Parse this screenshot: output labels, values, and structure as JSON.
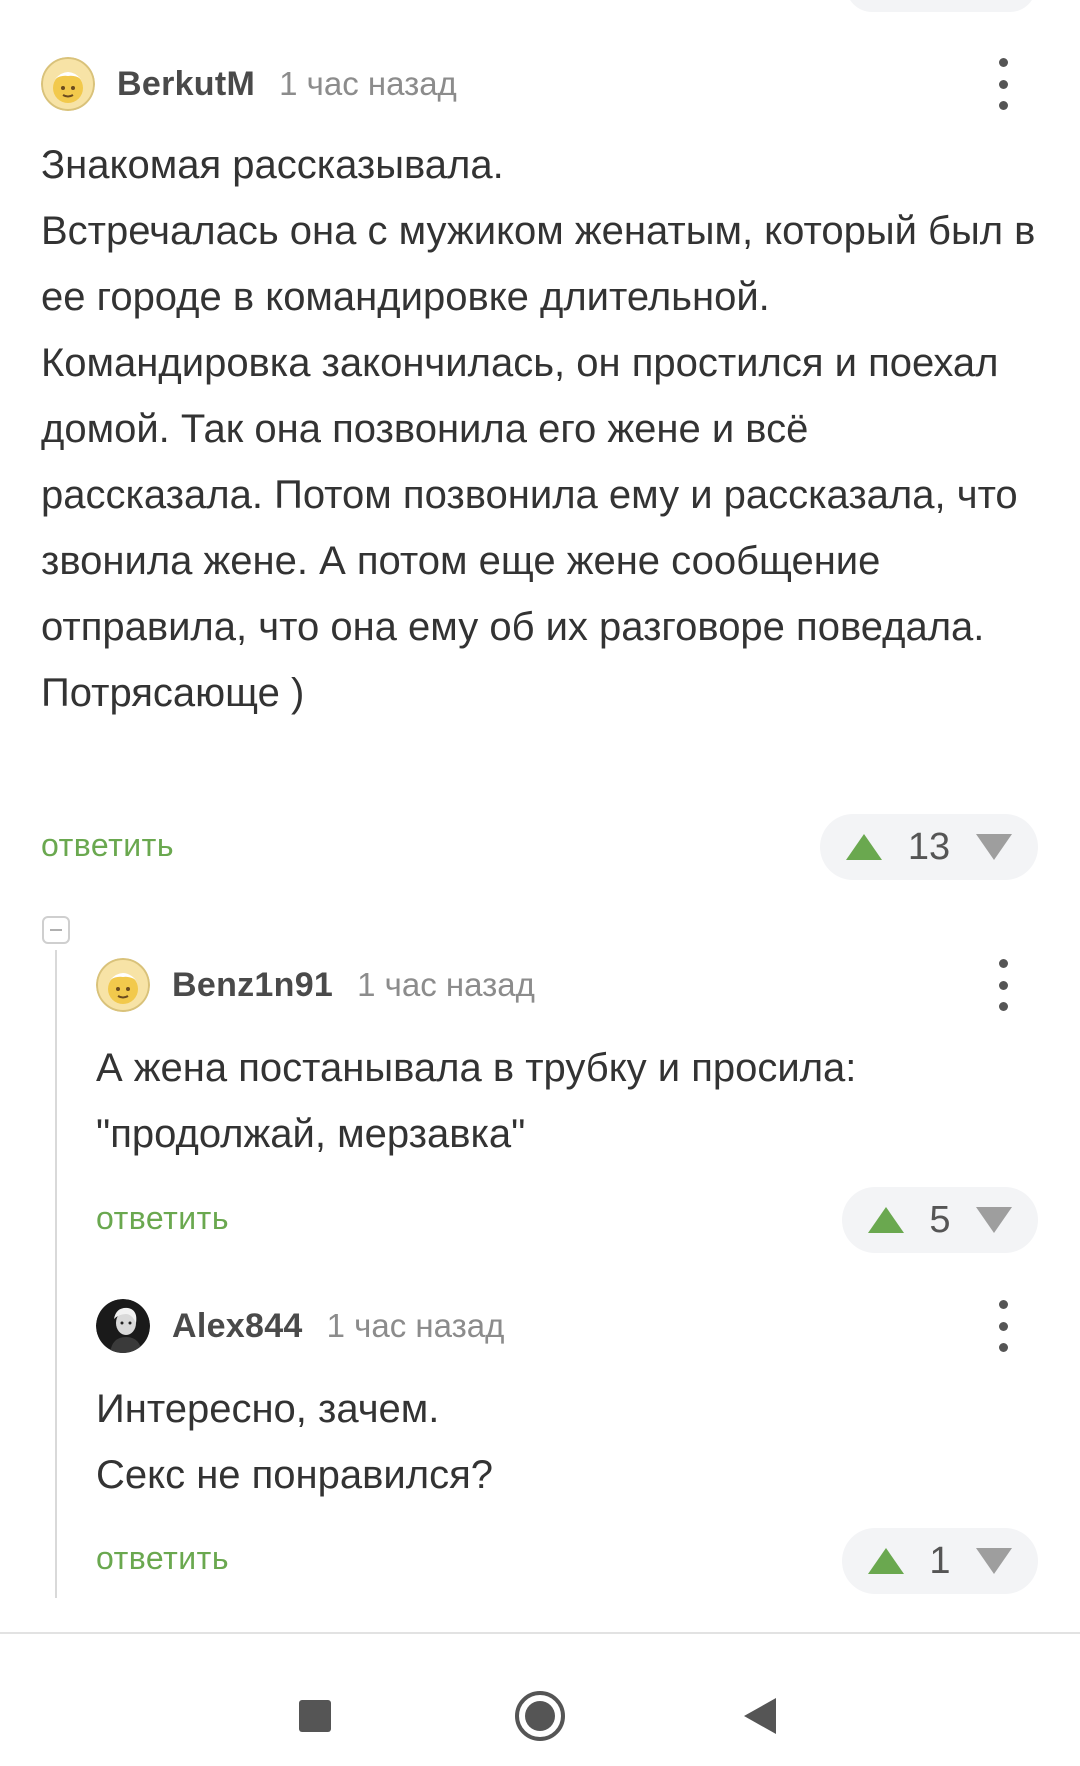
{
  "comments": [
    {
      "username": "BerkutM",
      "time": "1 час назад",
      "text": "Знакомая рассказывала.\nВстречалась она с мужиком женатым, который был в ее городе в командировке длительной. Командировка закончилась, он простился и поехал домой. Так она позвонила его жене и всё рассказала. Потом позвонила ему и рассказала, что звонила жене. А потом еще жене сообщение отправила, что она ему об их разговоре поведала.\nПотрясающе )",
      "reply_label": "ответить",
      "rating": "13"
    },
    {
      "username": "Benz1n91",
      "time": "1 час назад",
      "text": "А жена постанывала в трубку и просила: \"продолжай, мерзавка\"",
      "reply_label": "ответить",
      "rating": "5"
    },
    {
      "username": "Alex844",
      "time": "1 час назад",
      "text": "Интересно, зачем.\nСекс не понравился?",
      "reply_label": "ответить",
      "rating": "1"
    }
  ],
  "icons": {
    "vote_up": "triangle-up-icon",
    "vote_down": "triangle-down-icon",
    "more": "vertical-dots-icon",
    "nav_recents": "square-icon",
    "nav_home": "circle-icon",
    "nav_back": "triangle-left-icon"
  },
  "colors": {
    "accent_green": "#6aa84f",
    "vote_down_grey": "#9e9e9e",
    "text": "#333333",
    "meta": "#8c8c8c"
  }
}
